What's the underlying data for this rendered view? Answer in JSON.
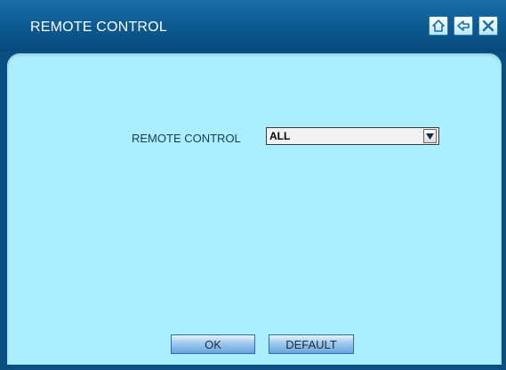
{
  "window": {
    "title": "REMOTE CONTROL",
    "buttons": {
      "home_icon": "home-icon",
      "back_icon": "back-arrow-icon",
      "close_icon": "close-icon"
    }
  },
  "form": {
    "remote_control_label": "REMOTE CONTROL",
    "remote_control_value": "ALL",
    "dropdown_icon": "chevron-down-icon"
  },
  "actions": {
    "ok_label": "OK",
    "default_label": "DEFAULT"
  },
  "colors": {
    "titlebar": "#0d5c93",
    "panel": "#abefff",
    "button": "#9fc8ef"
  }
}
